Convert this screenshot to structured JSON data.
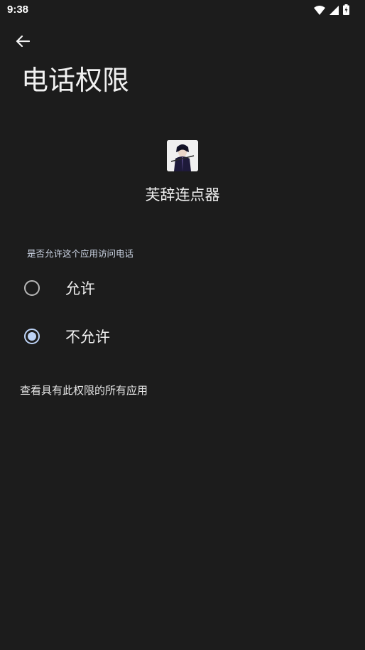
{
  "status_bar": {
    "time": "9:38",
    "icons": [
      "wifi-icon",
      "cell-signal-icon",
      "battery-icon"
    ]
  },
  "header": {
    "back_icon": "arrow-left-icon",
    "title": "电话权限"
  },
  "app": {
    "name": "芙辞连点器",
    "icon": "app-avatar-icon"
  },
  "permission": {
    "question": "是否允许这个应用访问电话",
    "options": [
      {
        "label": "允许",
        "selected": false
      },
      {
        "label": "不允许",
        "selected": true
      }
    ]
  },
  "footer": {
    "view_all_label": "查看具有此权限的所有应用"
  },
  "colors": {
    "background": "#1c1c1c",
    "accent": "#bcd2f5",
    "text": "#f0f0f0"
  }
}
